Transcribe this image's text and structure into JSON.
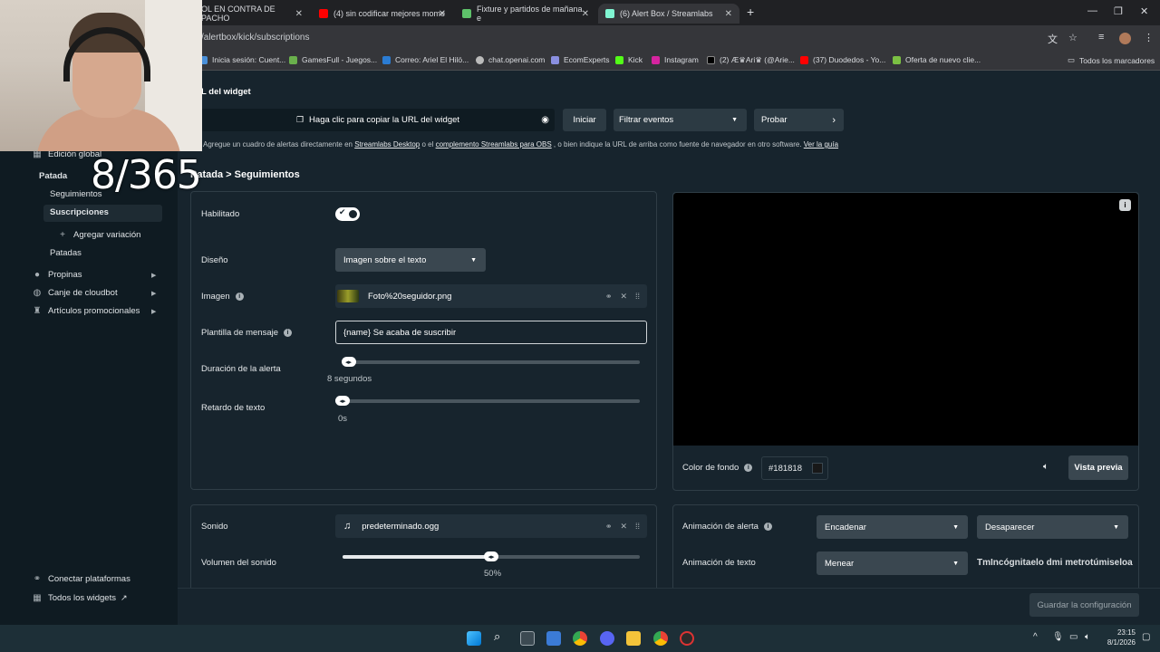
{
  "browser": {
    "tabs": [
      {
        "label": "OL EN CONTRA DE PACHO",
        "icon": "page-icon"
      },
      {
        "label": "(4) sin codificar mejores mome",
        "icon": "youtube-icon"
      },
      {
        "label": "Fixture y partidos de mañana e",
        "icon": "soccer-icon"
      },
      {
        "label": "(6) Alert Box / Streamlabs",
        "icon": "streamlabs-icon"
      }
    ],
    "url": "/alertbox/kick/subscriptions",
    "bookmarks": [
      "Inicia sesión: Cuent...",
      "GamesFull - Juegos...",
      "Correo: Ariel El Hilö...",
      "chat.openai.com",
      "EcomExperts",
      "Kick",
      "Instagram",
      "(2) Æ♛Ari♛ (@Arie...",
      "(37) Duodedos - Yo...",
      "Oferta de nuevo clie..."
    ],
    "all_bookmarks": "Todos los marcadores"
  },
  "overlay": {
    "counter": "8/365"
  },
  "sidebar": {
    "global_edit": "Edición global",
    "kick": "Patada",
    "follows": "Seguimientos",
    "subscriptions": "Suscripciones",
    "add_variation": "Agregar variación",
    "kicks": "Patadas",
    "tips": "Propinas",
    "cloudbot": "Canje de cloudbot",
    "merch": "Artículos promocionales",
    "connect": "Conectar plataformas",
    "all_widgets": "Todos los widgets"
  },
  "widget": {
    "title": "L del widget",
    "copy_url": "Haga clic para copiar la URL del widget",
    "start": "Iniciar",
    "filter": "Filtrar eventos",
    "test": "Probar",
    "help_prefix": "Agregue un cuadro de alertas directamente en ",
    "help_link1": "Streamlabs Desktop",
    "help_mid": " o el ",
    "help_link2": "complemento Streamlabs para OBS",
    "help_suffix": " , o bien indique la URL de arriba como fuente de navegador en otro software. ",
    "help_link3": "Ver la guía"
  },
  "breadcrumb": "Patada > Seguimientos",
  "settings": {
    "enabled_label": "Habilitado",
    "enabled": true,
    "design_label": "Diseño",
    "design_value": "Imagen sobre el texto",
    "image_label": "Imagen",
    "image_file": "Foto%20seguidor.png",
    "template_label": "Plantilla de mensaje",
    "template_value": "{name} Se acaba de suscribir",
    "duration_label": "Duración de la alerta",
    "duration_value": "8 segundos",
    "duration_level": 0.02,
    "delay_label": "Retardo de texto",
    "delay_value": "0s",
    "delay_level": 0.0
  },
  "preview": {
    "bg_label": "Color de fondo",
    "bg_color": "#181818",
    "preview_button": "Vista previa"
  },
  "sound": {
    "label": "Sonido",
    "file": "predeterminado.ogg",
    "volume_label": "Volumen del sonido",
    "volume_value": "50%",
    "volume_level": 0.5
  },
  "animation": {
    "alert_label": "Animación de alerta",
    "alert_in": "Encadenar",
    "alert_out": "Desaparecer",
    "text_label": "Animación de texto",
    "text_anim": "Menear",
    "text_preview": "TmIncógnitaelo dmi metrotúmiseloa"
  },
  "save": "Guardar la configuración",
  "clock": {
    "time": "23:15",
    "date": "8/1/2026"
  }
}
